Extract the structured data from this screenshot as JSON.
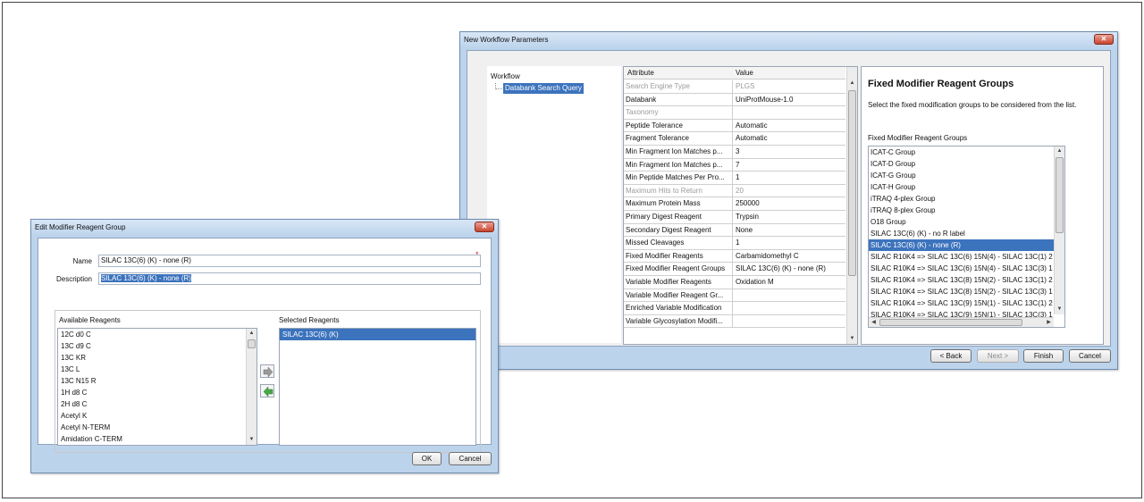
{
  "main_window": {
    "title": "New Workflow Parameters",
    "close_glyph": "✕",
    "workflow_label": "Workflow",
    "workflow_item": "Databank Search Query",
    "grid": {
      "headers": [
        "Attribute",
        "Value"
      ],
      "rows": [
        {
          "attr": "Search Engine Type",
          "val": "PLGS",
          "disabled": true
        },
        {
          "attr": "Databank",
          "val": "UniProtMouse-1.0",
          "disabled": false
        },
        {
          "attr": "Taxonomy",
          "val": "",
          "disabled": true
        },
        {
          "attr": "Peptide Tolerance",
          "val": "Automatic",
          "disabled": false
        },
        {
          "attr": "Fragment Tolerance",
          "val": "Automatic",
          "disabled": false
        },
        {
          "attr": "Min Fragment Ion Matches p...",
          "val": "3",
          "disabled": false
        },
        {
          "attr": "Min Fragment Ion Matches p...",
          "val": "7",
          "disabled": false
        },
        {
          "attr": "Min Peptide Matches Per Pro...",
          "val": "1",
          "disabled": false
        },
        {
          "attr": "Maximum Hits to Return",
          "val": "20",
          "disabled": true
        },
        {
          "attr": "Maximum Protein Mass",
          "val": "250000",
          "disabled": false
        },
        {
          "attr": "Primary Digest Reagent",
          "val": "Trypsin",
          "disabled": false
        },
        {
          "attr": "Secondary Digest Reagent",
          "val": "None",
          "disabled": false
        },
        {
          "attr": "Missed Cleavages",
          "val": "1",
          "disabled": false
        },
        {
          "attr": "Fixed Modifier Reagents",
          "val": "Carbamidomethyl C",
          "disabled": false
        },
        {
          "attr": "Fixed Modifier Reagent Groups",
          "val": "SILAC 13C(6) (K) - none (R)",
          "disabled": false
        },
        {
          "attr": "Variable Modifier Reagents",
          "val": "Oxidation M",
          "disabled": false
        },
        {
          "attr": "Variable Modifier Reagent Gr...",
          "val": "",
          "disabled": false
        },
        {
          "attr": "Enriched Variable Modification",
          "val": "",
          "disabled": false
        },
        {
          "attr": "Variable Glycosylation Modifi...",
          "val": "",
          "disabled": false
        }
      ]
    },
    "fixed_modifier": {
      "heading": "Fixed Modifier Reagent Groups",
      "description": "Select the fixed modification groups to be considered from the list.",
      "list_label": "Fixed Modifier Reagent Groups",
      "selected_index": 8,
      "items": [
        "ICAT-C Group",
        "ICAT-D Group",
        "ICAT-G Group",
        "ICAT-H Group",
        "iTRAQ 4-plex Group",
        "iTRAQ 8-plex Group",
        "O18 Group",
        "SILAC 13C(6) (K) - no R label",
        "SILAC 13C(6) (K) - none (R)",
        "SILAC R10K4 => SILAC 13C(6) 15N(4) - SILAC 13C(1) 2",
        "SILAC R10K4 => SILAC 13C(6) 15N(4) - SILAC 13C(3) 1",
        "SILAC R10K4 => SILAC 13C(8) 15N(2) - SILAC 13C(1) 2",
        "SILAC R10K4 => SILAC 13C(8) 15N(2) - SILAC 13C(3) 1",
        "SILAC R10K4 => SILAC 13C(9) 15N(1) - SILAC 13C(1) 2",
        "SILAC R10K4 => SILAC 13C(9) 15N(1) - SILAC 13C(3) 1"
      ]
    },
    "buttons": {
      "back": "< Back",
      "next": "Next >",
      "finish": "Finish",
      "cancel": "Cancel"
    }
  },
  "edit_dialog": {
    "title": "Edit Modifier Reagent Group",
    "close_glyph": "✕",
    "name_label": "Name",
    "name_value": "SILAC 13C(6) (K) - none (R)",
    "description_label": "Description",
    "description_value": "SILAC 13C(6) (K) - none (R)",
    "required_mark": "*",
    "available_label": "Available Reagents",
    "available": [
      "12C d0 C",
      "13C d9 C",
      "13C KR",
      "13C L",
      "13C N15 R",
      "1H d8 C",
      "2H d8 C",
      "Acetyl K",
      "Acetyl N-TERM",
      "Amidation C-TERM"
    ],
    "selected_label": "Selected Reagents",
    "selected": [
      "SILAC 13C(6) (K)"
    ],
    "buttons": {
      "ok": "OK",
      "cancel": "Cancel"
    }
  },
  "icons": {
    "add": "right-arrow-icon",
    "remove": "left-arrow-icon"
  },
  "colors": {
    "selection": "#3c73bd",
    "window_frame": "#bcd3ec",
    "close_button": "#c8452f",
    "arrow_green": "#4aa84a"
  }
}
